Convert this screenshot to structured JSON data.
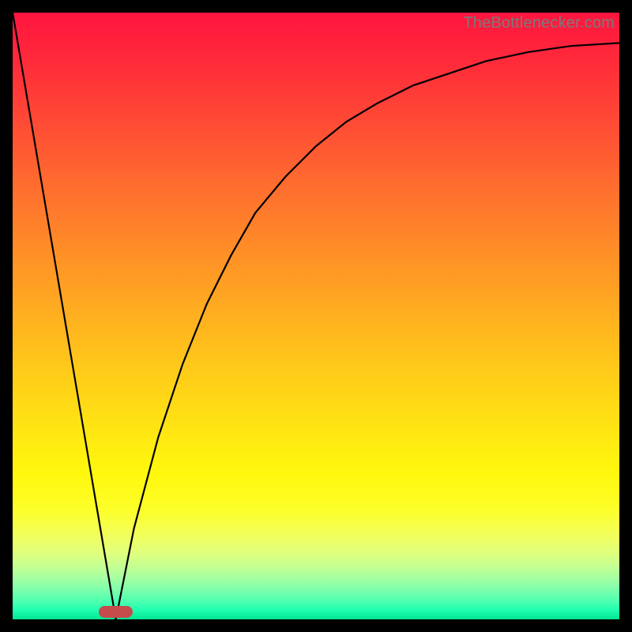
{
  "watermark": "TheBottlenecker.com",
  "colors": {
    "frame": "#000000",
    "curve": "#000000",
    "marker": "#c64b4b"
  },
  "marker": {
    "x": 0.17,
    "width_frac": 0.057
  },
  "chart_data": {
    "type": "line",
    "title": "",
    "xlabel": "",
    "ylabel": "",
    "xlim": [
      0,
      1
    ],
    "ylim": [
      0,
      1
    ],
    "annotations": [
      "TheBottlenecker.com"
    ],
    "legend": false,
    "grid": false,
    "background": "vertical-gradient red→green",
    "series": [
      {
        "name": "left-linear",
        "x": [
          0.0,
          0.17
        ],
        "values": [
          1.0,
          0.0
        ]
      },
      {
        "name": "right-curve",
        "x": [
          0.17,
          0.2,
          0.24,
          0.28,
          0.32,
          0.36,
          0.4,
          0.45,
          0.5,
          0.55,
          0.6,
          0.66,
          0.72,
          0.78,
          0.85,
          0.92,
          1.0
        ],
        "values": [
          0.0,
          0.15,
          0.3,
          0.42,
          0.52,
          0.6,
          0.67,
          0.73,
          0.78,
          0.82,
          0.85,
          0.88,
          0.9,
          0.92,
          0.935,
          0.945,
          0.95
        ]
      }
    ],
    "marker": {
      "x_center": 0.17,
      "y": 0.0,
      "width_frac": 0.057
    }
  }
}
